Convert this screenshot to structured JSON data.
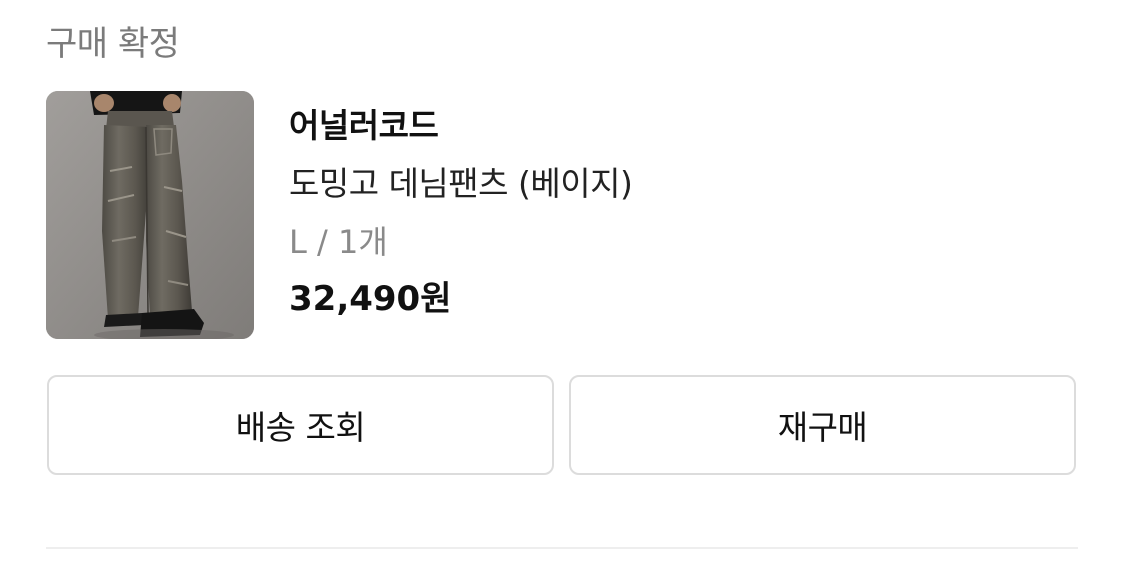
{
  "order": {
    "status": "구매 확정"
  },
  "product": {
    "brand": "어널러코드",
    "name": "도밍고 데님팬츠 (베이지)",
    "option": "L / 1개",
    "price": "32,490원"
  },
  "actions": {
    "track_label": "배송 조회",
    "rebuy_label": "재구매"
  }
}
